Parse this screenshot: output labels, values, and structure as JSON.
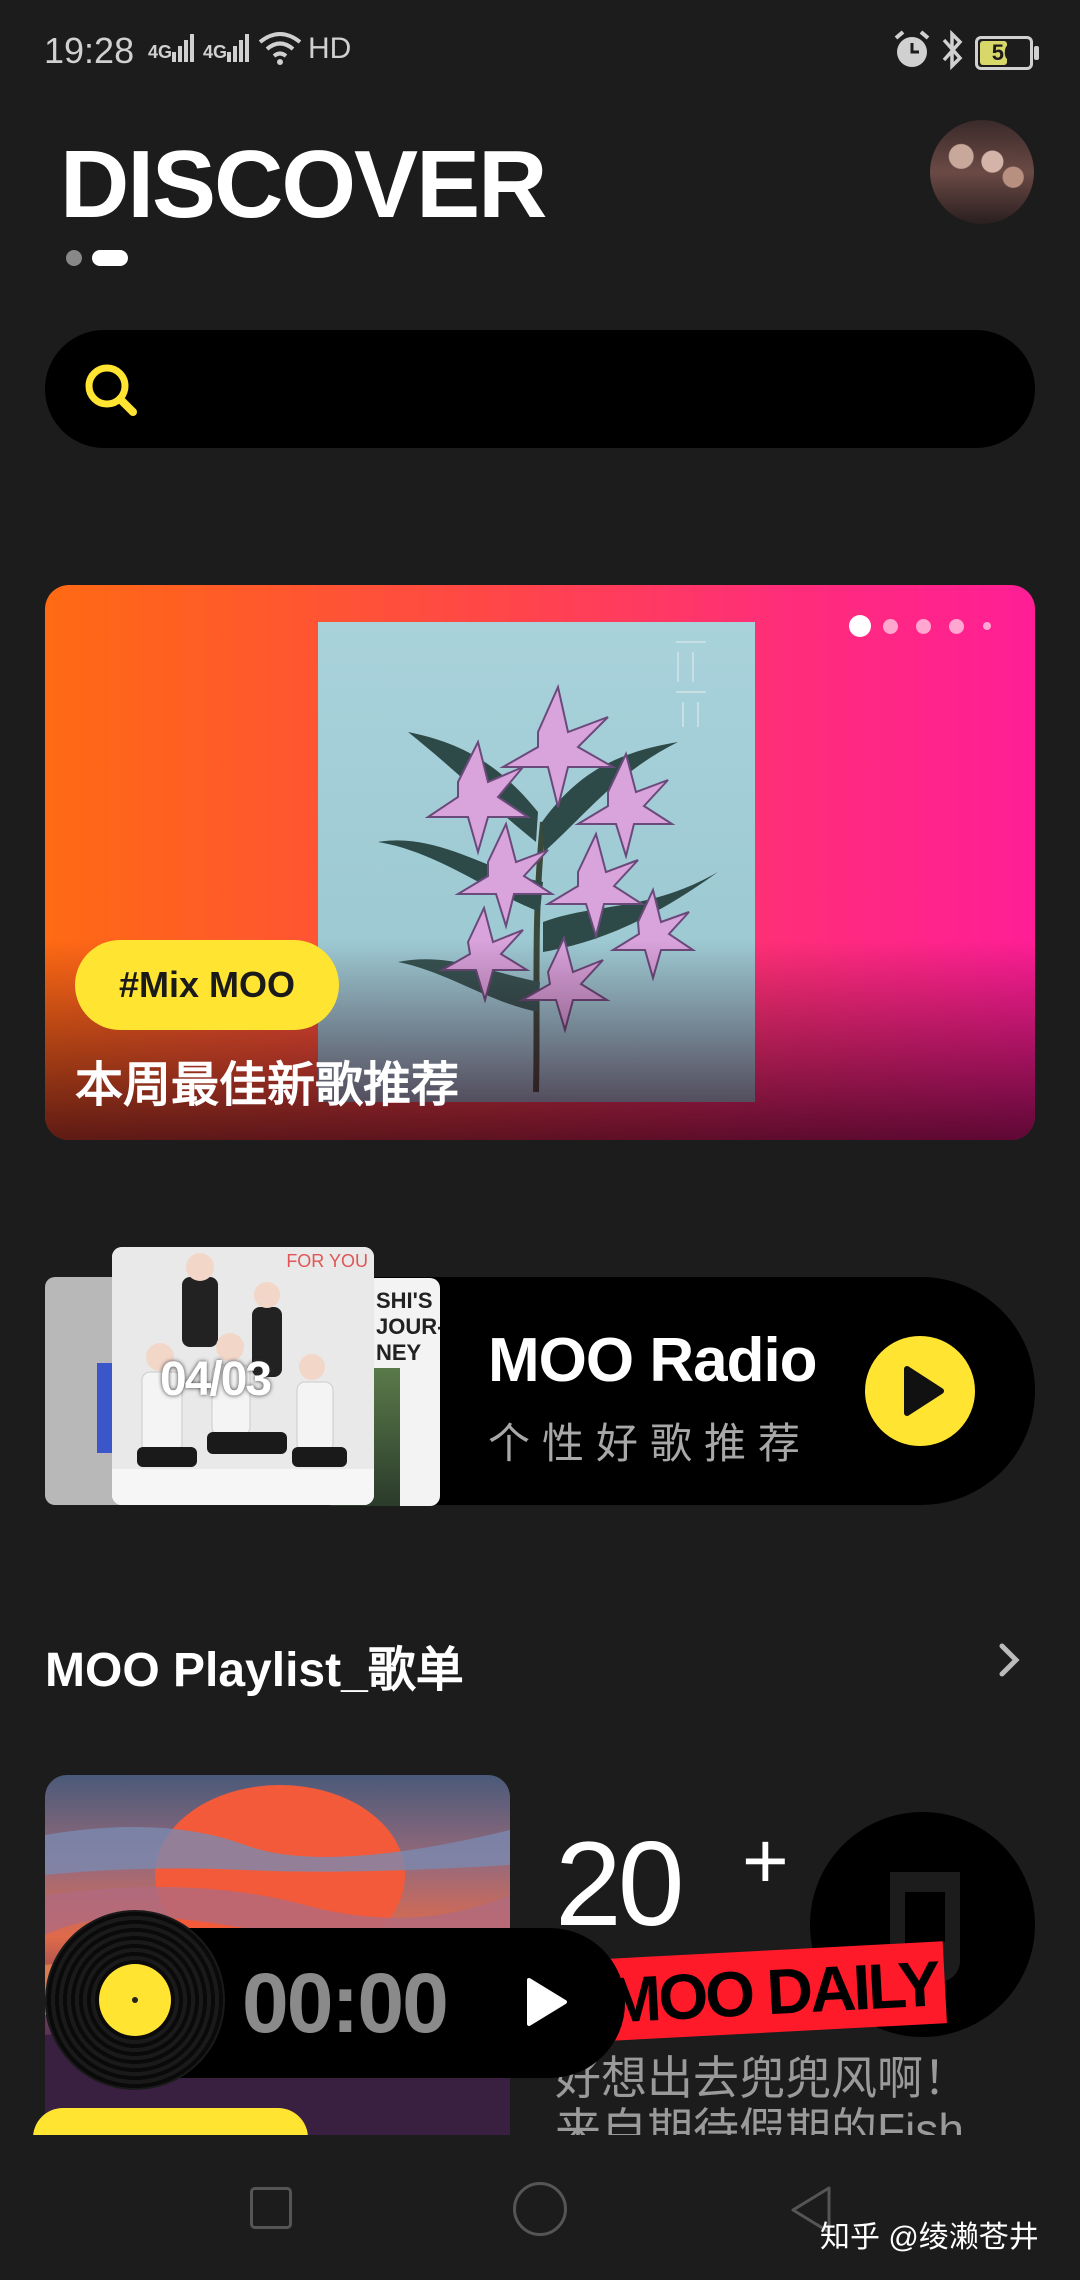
{
  "status_bar": {
    "time": "19:28",
    "signal_1": "4G",
    "signal_2": "4G",
    "hd": "HD",
    "battery": "56",
    "battery_level": 0.56
  },
  "header": {
    "title": "DISCOVER",
    "page_indicator": {
      "count": 2,
      "active_index": 1
    }
  },
  "search": {
    "placeholder": ""
  },
  "banner": {
    "tag": "#Mix MOO",
    "caption": "本周最佳新歌推荐",
    "slide_count": 5,
    "active_slide": 0
  },
  "radio": {
    "title": "MOO Radio",
    "subtitle": "个性好歌推荐",
    "cover_date": "04/03",
    "cover_badge": "FOR YOU",
    "back_cover_text": "SHI'S\nJOUR-\nNEY"
  },
  "playlist_section": {
    "title": "MOO Playlist_歌单",
    "count": "20",
    "count_suffix": "+",
    "brand": "MOO DAILY",
    "description": "好想出去兜兜风啊！\n来自期待假期的Fish"
  },
  "mini_player": {
    "time": "00:00"
  },
  "watermark": "知乎 @绫濑苍井",
  "colors": {
    "accent": "#ffe432",
    "background": "#1c1c1c"
  }
}
